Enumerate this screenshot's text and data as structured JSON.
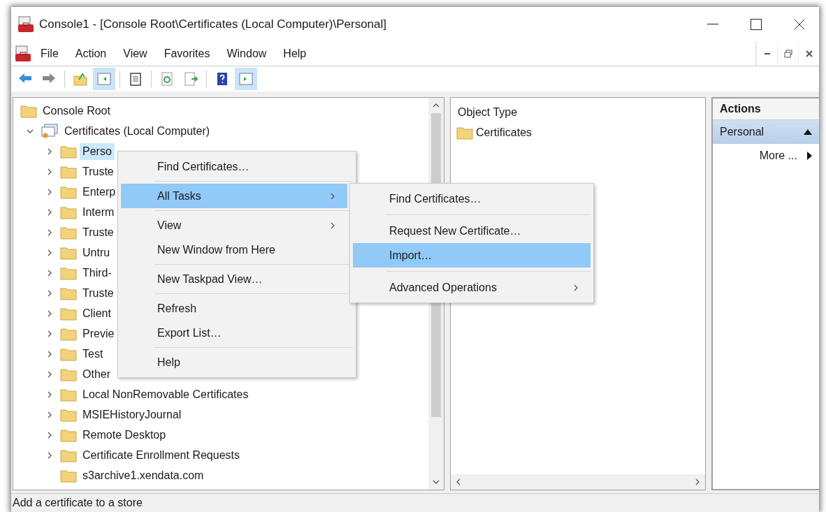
{
  "window": {
    "title": "Console1 - [Console Root\\Certificates (Local Computer)\\Personal]"
  },
  "menu_bar": [
    "File",
    "Action",
    "View",
    "Favorites",
    "Window",
    "Help"
  ],
  "toolbar": [
    {
      "pressed": false
    },
    {
      "pressed": false
    },
    {
      "pressed": false
    },
    {
      "pressed": true
    },
    {
      "pressed": false
    },
    {
      "pressed": false
    },
    {
      "pressed": false
    },
    {
      "pressed": false
    },
    {
      "pressed": true
    }
  ],
  "tree": {
    "items": [
      {
        "label": "Console Root",
        "kind": "folder",
        "expandable": false,
        "selected": false,
        "children": [
          {
            "label": "Certificates (Local Computer)",
            "kind": "store",
            "expandable": true,
            "expanded": true,
            "selected": false,
            "children": [
              {
                "label": "Perso",
                "kind": "folder",
                "expandable": true,
                "expanded": false,
                "selected": true
              },
              {
                "label": "Truste",
                "kind": "folder",
                "expandable": true,
                "expanded": false,
                "selected": false
              },
              {
                "label": "Enterp",
                "kind": "folder",
                "expandable": true,
                "expanded": false,
                "selected": false
              },
              {
                "label": "Interm",
                "kind": "folder",
                "expandable": true,
                "expanded": false,
                "selected": false
              },
              {
                "label": "Truste",
                "kind": "folder",
                "expandable": true,
                "expanded": false,
                "selected": false
              },
              {
                "label": "Untru",
                "kind": "folder",
                "expandable": true,
                "expanded": false,
                "selected": false
              },
              {
                "label": "Third-",
                "kind": "folder",
                "expandable": true,
                "expanded": false,
                "selected": false
              },
              {
                "label": "Truste",
                "kind": "folder",
                "expandable": true,
                "expanded": false,
                "selected": false
              },
              {
                "label": "Client",
                "kind": "folder",
                "expandable": true,
                "expanded": false,
                "selected": false
              },
              {
                "label": "Previe",
                "kind": "folder",
                "expandable": true,
                "expanded": false,
                "selected": false
              },
              {
                "label": "Test",
                "kind": "folder",
                "expandable": true,
                "expanded": false,
                "selected": false
              },
              {
                "label": "Other",
                "kind": "folder",
                "expandable": true,
                "expanded": false,
                "selected": false
              },
              {
                "label": "Local NonRemovable Certificates",
                "kind": "folder",
                "expandable": true,
                "expanded": false,
                "selected": false
              },
              {
                "label": "MSIEHistoryJournal",
                "kind": "folder",
                "expandable": true,
                "expanded": false,
                "selected": false
              },
              {
                "label": "Remote Desktop",
                "kind": "folder",
                "expandable": true,
                "expanded": false,
                "selected": false
              },
              {
                "label": "Certificate Enrollment Requests",
                "kind": "folder",
                "expandable": true,
                "expanded": false,
                "selected": false
              },
              {
                "label": "s3archive1.xendata.com",
                "kind": "folder",
                "expandable": false,
                "selected": false
              }
            ]
          }
        ]
      }
    ]
  },
  "context_menu": {
    "items": [
      {
        "kind": "item",
        "label": "Find Certificates…",
        "selected": false,
        "has_submenu": false
      },
      {
        "kind": "separator"
      },
      {
        "kind": "item",
        "label": "All Tasks",
        "selected": true,
        "has_submenu": true
      },
      {
        "kind": "separator"
      },
      {
        "kind": "item",
        "label": "View",
        "selected": false,
        "has_submenu": true
      },
      {
        "kind": "item",
        "label": "New Window from Here",
        "selected": false,
        "has_submenu": false
      },
      {
        "kind": "separator"
      },
      {
        "kind": "item",
        "label": "New Taskpad View…",
        "selected": false,
        "has_submenu": false
      },
      {
        "kind": "separator"
      },
      {
        "kind": "item",
        "label": "Refresh",
        "selected": false,
        "has_submenu": false
      },
      {
        "kind": "item",
        "label": "Export List…",
        "selected": false,
        "has_submenu": false
      },
      {
        "kind": "separator"
      },
      {
        "kind": "item",
        "label": "Help",
        "selected": false,
        "has_submenu": false
      }
    ]
  },
  "submenu": {
    "items": [
      {
        "kind": "item",
        "label": "Find Certificates…",
        "selected": false,
        "has_submenu": false
      },
      {
        "kind": "separator"
      },
      {
        "kind": "item",
        "label": "Request New Certificate…",
        "selected": false,
        "has_submenu": false
      },
      {
        "kind": "item",
        "label": "Import…",
        "selected": true,
        "has_submenu": false
      },
      {
        "kind": "separator"
      },
      {
        "kind": "item",
        "label": "Advanced Operations",
        "selected": false,
        "has_submenu": true
      }
    ]
  },
  "list_pane": {
    "columns": [
      "Object Type"
    ],
    "rows": [
      {
        "label": "Certificates"
      }
    ]
  },
  "actions": {
    "title": "Actions",
    "sections": [
      {
        "label": "Personal",
        "expanded": true,
        "items": [
          {
            "label": "More ...",
            "has_submenu": true
          }
        ]
      }
    ]
  },
  "status_bar": {
    "text": "Add a certificate to a store"
  }
}
